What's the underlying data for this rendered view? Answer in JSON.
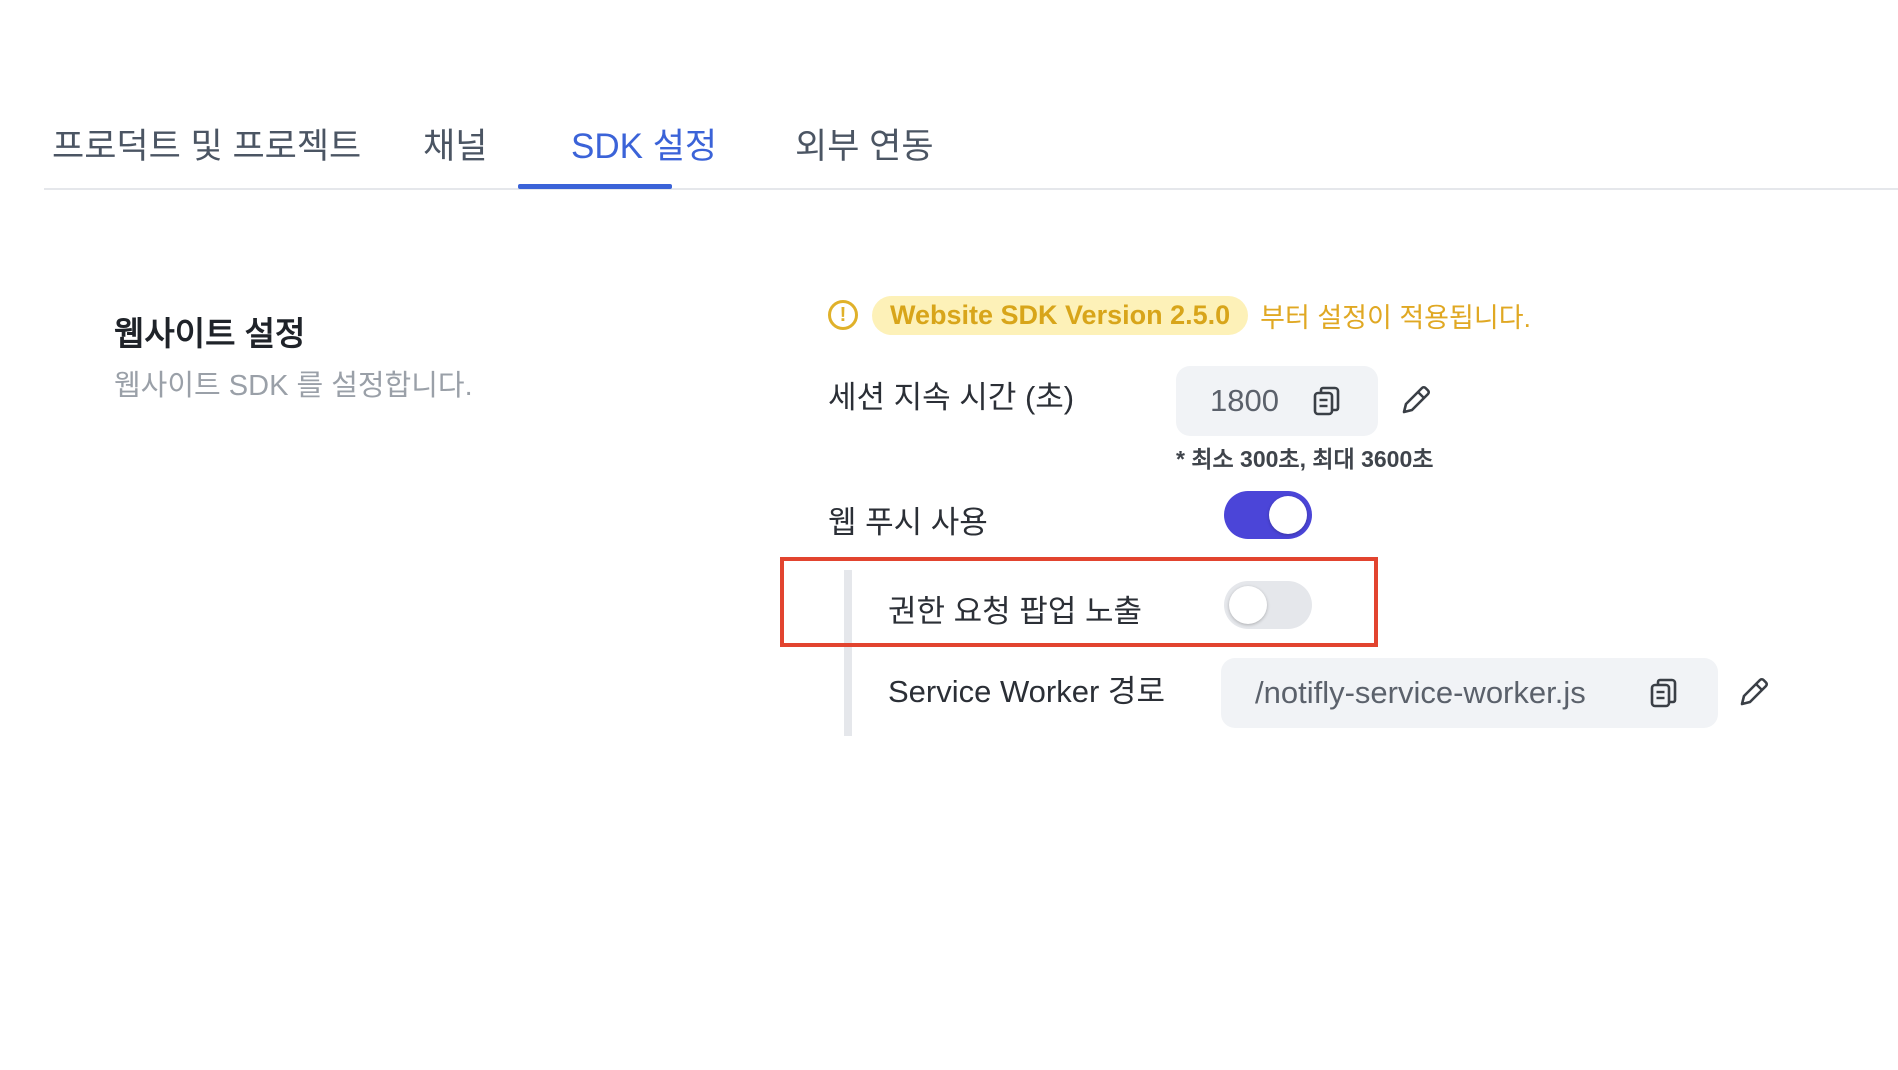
{
  "tabs": [
    {
      "label": "프로덕트 및 프로젝트",
      "active": false
    },
    {
      "label": "채널",
      "active": false
    },
    {
      "label": "SDK 설정",
      "active": true
    },
    {
      "label": "외부 연동",
      "active": false
    }
  ],
  "section": {
    "title": "웹사이트 설정",
    "description": "웹사이트 SDK 를 설정합니다."
  },
  "notice": {
    "icon": "exclamation-circle-icon",
    "version": "Website SDK Version 2.5.0",
    "text": "부터 설정이 적용됩니다."
  },
  "session": {
    "label": "세션 지속 시간 (초)",
    "value": "1800",
    "hint": "* 최소 300초, 최대 3600초"
  },
  "web_push": {
    "label": "웹 푸시 사용",
    "enabled": true
  },
  "permission_popup": {
    "label": "권한 요청 팝업 노출",
    "enabled": false
  },
  "service_worker": {
    "label": "Service Worker 경로",
    "value": "/notifly-service-worker.js"
  },
  "colors": {
    "accent": "#3b63d8",
    "toggle_on": "#4b45d8",
    "warning": "#e0b12a",
    "highlight": "#e2442f"
  }
}
